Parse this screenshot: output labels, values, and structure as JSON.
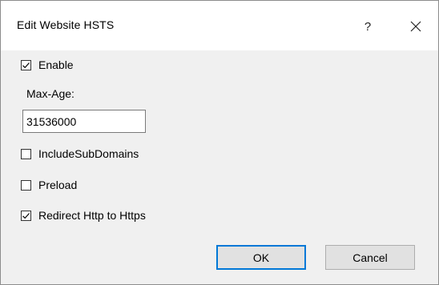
{
  "window": {
    "title": "Edit Website HSTS",
    "help_icon": "question-mark",
    "help_glyph": "?",
    "close_icon": "close-x"
  },
  "form": {
    "enable": {
      "label": "Enable",
      "checked": true
    },
    "max_age": {
      "label": "Max-Age:",
      "value": "31536000"
    },
    "include_subdomains": {
      "label": "IncludeSubDomains",
      "checked": false
    },
    "preload": {
      "label": "Preload",
      "checked": false
    },
    "redirect": {
      "label": "Redirect Http to Https",
      "checked": true
    }
  },
  "buttons": {
    "ok": "OK",
    "cancel": "Cancel"
  },
  "colors": {
    "dialog_bg": "#f0f0f0",
    "titlebar_bg": "#ffffff",
    "default_button_border": "#0078d7"
  }
}
